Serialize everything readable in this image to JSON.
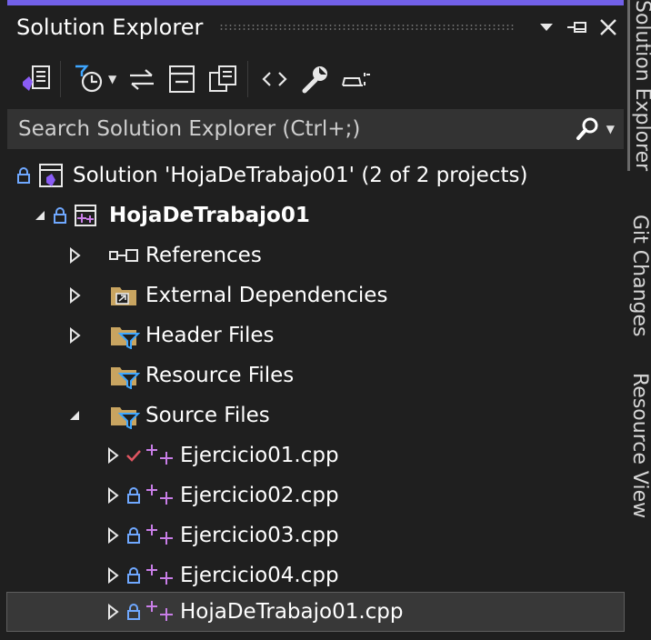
{
  "window": {
    "title": "Solution Explorer",
    "pin_icon": "pin-icon",
    "close_icon": "close-icon",
    "dropdown_icon": "window-options-icon"
  },
  "toolbar": {
    "items": [
      "switch-views-icon",
      "pending-changes-filter-icon",
      "sync-with-active-document-icon",
      "collapse-all-icon",
      "show-all-files-icon",
      "preview-code-icon",
      "properties-wrench-icon",
      "preview-selected-items-icon"
    ]
  },
  "search": {
    "placeholder": "Search Solution Explorer (Ctrl+;)"
  },
  "tree": {
    "solution": "Solution 'HojaDeTrabajo01' (2 of 2 projects)",
    "project": "HojaDeTrabajo01",
    "references": "References",
    "external_dependencies": "External Dependencies",
    "header_files": "Header Files",
    "resource_files": "Resource Files",
    "source_files": "Source Files",
    "files": [
      {
        "name": "Ejercicio01.cpp",
        "status": "checked-in"
      },
      {
        "name": "Ejercicio02.cpp",
        "status": "locked"
      },
      {
        "name": "Ejercicio03.cpp",
        "status": "locked"
      },
      {
        "name": "Ejercicio04.cpp",
        "status": "locked"
      },
      {
        "name": "HojaDeTrabajo01.cpp",
        "status": "locked"
      }
    ]
  },
  "side_tabs": {
    "solution_explorer": "Solution Explorer",
    "git_changes": "Git Changes",
    "resource_view": "Resource View"
  },
  "colors": {
    "accent": "#7160e8",
    "background": "#1f1f1f",
    "search_bg": "#333333",
    "selection": "#383838",
    "lock": "#6fa8ff",
    "check": "#e05561",
    "folder": "#c8a460",
    "filter": "#3ea6ff",
    "cpp_plus": "#c97ee8"
  }
}
